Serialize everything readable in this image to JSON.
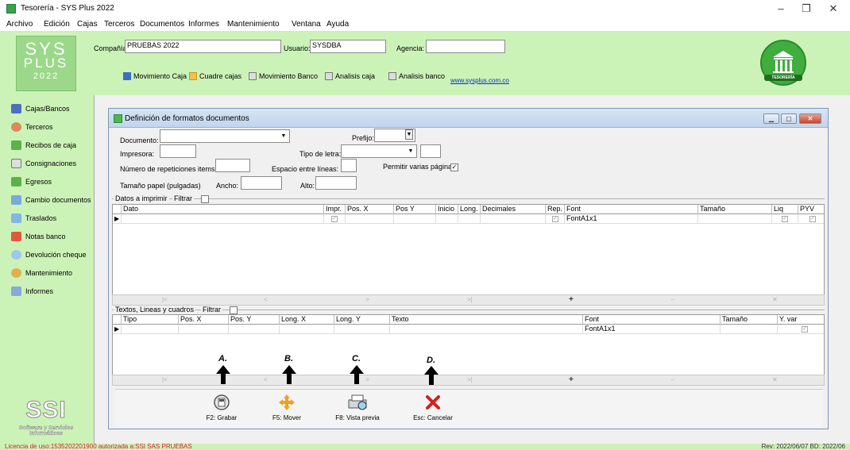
{
  "window": {
    "title": "Tesorería - SYS Plus 2022",
    "controls": [
      "–",
      "❐",
      "✕"
    ]
  },
  "menu": [
    "Archivo",
    "Edición",
    "Cajas",
    "Terceros",
    "Documentos",
    "Informes",
    "Mantenimiento",
    "Ventana",
    "Ayuda"
  ],
  "header": {
    "logo": {
      "line1": "SYS",
      "line2": "PLUS",
      "line3": "2022"
    },
    "company_label": "Compañía:",
    "company_value": "PRUEBAS 2022",
    "user_label": "Usuario:",
    "user_value": "SYSDBA",
    "agency_label": "Agencia:",
    "agency_value": "",
    "buttons": [
      "Movimiento Caja",
      "Cuadre cajas",
      "Movimiento Banco",
      "Analisis caja",
      "Analisis banco"
    ],
    "website": "www.sysplus.com.co",
    "badge": "TESORERÍA"
  },
  "sidebar": {
    "items": [
      "Cajas/Bancos",
      "Terceros",
      "Recibos de caja",
      "Consignaciones",
      "Egresos",
      "Cambio documentos",
      "Traslados",
      "Notas banco",
      "Devolución cheque",
      "Mantenimiento",
      "Informes"
    ],
    "company_logo": "SSI",
    "company_name_1": "Software y Servicios",
    "company_name_2": "Informáticos"
  },
  "dialog": {
    "title": "Definición de formatos documentos",
    "documento_label": "Documento:",
    "documento_value": "",
    "prefijo_label": "Prefijo:",
    "impresora_label": "Impresora:",
    "tipo_letra_label": "Tipo de letra:",
    "repeticiones_label": "Número de repeticiones items:",
    "espacio_label": "Espacio entre líneas:",
    "varias_paginas_label": "Permitir varias páginas",
    "varias_paginas_checked": true,
    "tamano_label": "Tamaño papel (pulgadas)",
    "ancho_label": "Ancho:",
    "alto_label": "Alto:"
  },
  "grid1": {
    "group_label": "Datos a imprimir",
    "filter_label": "Filtrar",
    "columns": [
      "Dato",
      "Impr.",
      "Pos. X",
      "Pos Y",
      "Inicio",
      "Long.",
      "Decimales",
      "Rep.",
      "Font",
      "Tamaño",
      "Liq",
      "PYV"
    ],
    "row": {
      "font": "FontA1x1"
    }
  },
  "grid2": {
    "group_label": "Textos, Lineas y cuadros",
    "filter_label": "Filtrar",
    "columns": [
      "Tipo",
      "Pos. X",
      "Pos. Y",
      "Long. X",
      "Long. Y",
      "Texto",
      "Font",
      "Tamaño",
      "Y. var"
    ],
    "row": {
      "font": "FontA1x1"
    }
  },
  "toolbar": {
    "save": "F2: Grabar",
    "move": "F5: Mover",
    "preview": "F8: Vista previa",
    "cancel": "Esc: Cancelar"
  },
  "annotations": [
    "A.",
    "B.",
    "C.",
    "D."
  ],
  "status": {
    "license": "Licencia de uso:1535202201900 autorizada a:SSI SAS PRUEBAS",
    "revision": "Rev: 2022/06/07 BD: 2022/06"
  },
  "colors": {
    "header_green": "#ccf3b7",
    "license_red": "#d62020",
    "link_blue": "#0033cc"
  }
}
